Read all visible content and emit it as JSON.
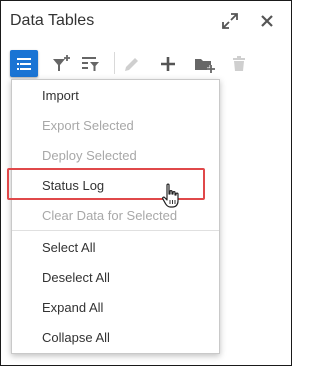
{
  "panel": {
    "title": "Data Tables"
  },
  "header_icons": [
    "expand-icon",
    "close-icon"
  ],
  "toolbar": {
    "icons": [
      "menu-icon",
      "filter-add-icon",
      "filter-list-icon",
      "edit-icon",
      "add-icon",
      "add-folder-icon",
      "delete-icon"
    ],
    "accent": "#1a74d4"
  },
  "menu": {
    "items": [
      {
        "label": "Import",
        "enabled": true
      },
      {
        "label": "Export Selected",
        "enabled": false
      },
      {
        "label": "Deploy Selected",
        "enabled": false
      },
      {
        "label": "Status Log",
        "enabled": true,
        "highlighted": true
      },
      {
        "label": "Clear Data for Selected",
        "enabled": false
      },
      {
        "label": "Select All",
        "enabled": true
      },
      {
        "label": "Deselect All",
        "enabled": true
      },
      {
        "label": "Expand All",
        "enabled": true
      },
      {
        "label": "Collapse All",
        "enabled": true
      }
    ],
    "highlight_color": "#e0484a"
  }
}
